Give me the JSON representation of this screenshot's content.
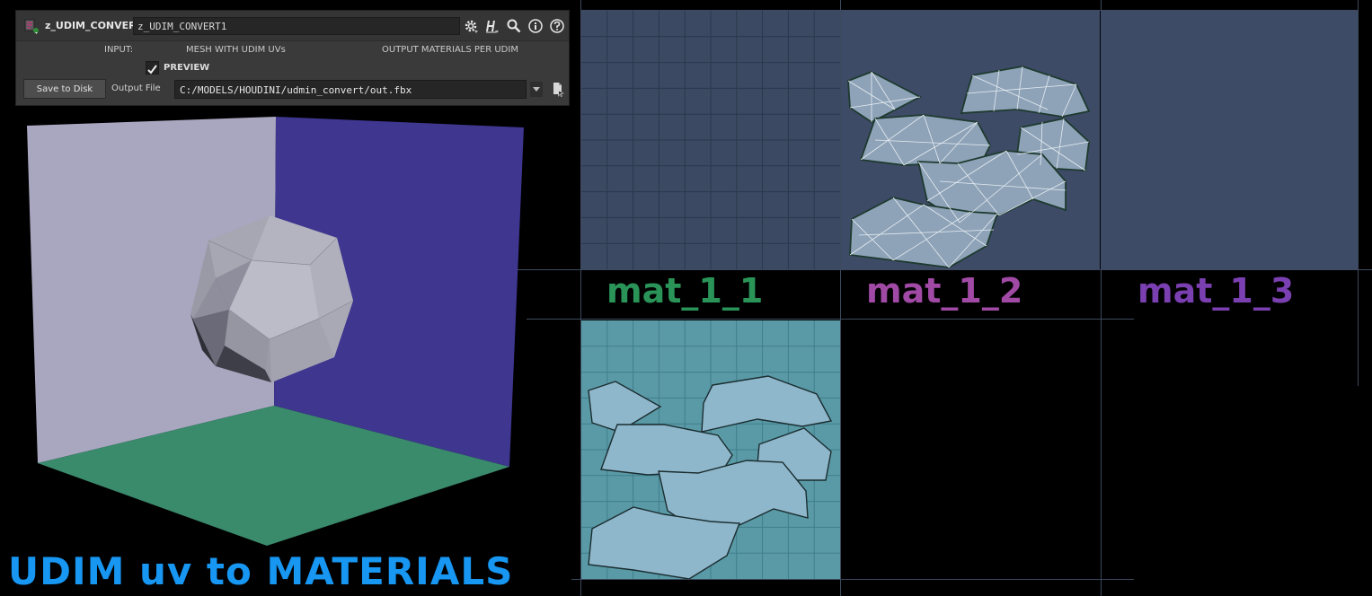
{
  "panel": {
    "node_type": "z_UDIM_CONVERT",
    "node_name": "z_UDIM_CONVERT1",
    "input_label": "INPUT:",
    "input_value": "MESH WITH UDIM UVs",
    "output_info": "OUTPUT MATERIALS PER UDIM",
    "preview_label": "PREVIEW",
    "preview_checked": true,
    "save_button": "Save to Disk",
    "output_file_label": "Output File",
    "output_file_value": "C:/MODELS/HOUDINI/udmin_convert/out.fbx",
    "icons": [
      "node-icon",
      "gear-icon",
      "houdini-help-icon",
      "search-icon",
      "info-icon",
      "help-icon",
      "chevron-down-icon",
      "file-browse-icon"
    ]
  },
  "title": "UDIM uv to MATERIALS",
  "tiles": {
    "mat_1_1": {
      "label": "mat_1_1",
      "color": "#2a9458"
    },
    "mat_1_2": {
      "label": "mat_1_2",
      "color": "#a04aa6"
    },
    "mat_1_3": {
      "label": "mat_1_3",
      "color": "#7a3fb0"
    }
  },
  "colors": {
    "wall_left": "#a9a7c0",
    "wall_right": "#3e368f",
    "floor": "#3a8a6c",
    "tile_blue": "#3e4b67",
    "tile_teal": "#5a9aa6",
    "title": "#1796f2"
  }
}
